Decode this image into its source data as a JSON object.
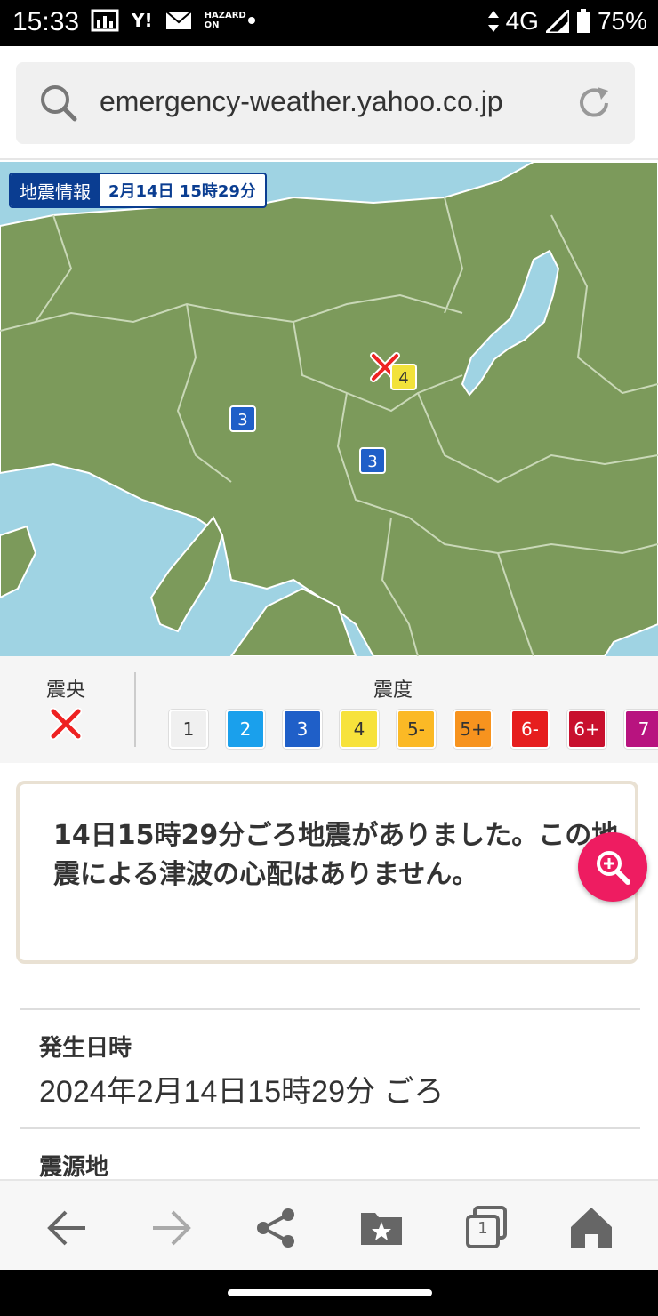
{
  "status": {
    "time": "15:33",
    "network": "4G",
    "battery": "75%",
    "icons": [
      "gallery-icon",
      "yahoo-icon",
      "mail-icon",
      "hazard-on-icon"
    ],
    "yahoo_text": "Y!",
    "hazard_text": "HAZARD ON"
  },
  "browser": {
    "url": "emergency-weather.yahoo.co.jp"
  },
  "map": {
    "badge_title": "地震情報",
    "badge_date": "2月14日 15時29分",
    "markers": [
      {
        "label": "4",
        "color": "#f2e23b"
      },
      {
        "label": "3",
        "color": "#1f5fc8"
      },
      {
        "label": "3",
        "color": "#1f5fc8"
      }
    ],
    "colors": {
      "land": "#7c9a5b",
      "sea": "#9fd3e3",
      "border": "#ffffff"
    }
  },
  "legend": {
    "epicenter_label": "震央",
    "intensity_label": "震度",
    "intensities": [
      {
        "label": "1",
        "color": "#f0f0f0",
        "text": "#333333"
      },
      {
        "label": "2",
        "color": "#1aa0ec",
        "text": "#ffffff"
      },
      {
        "label": "3",
        "color": "#1f5fc8",
        "text": "#ffffff"
      },
      {
        "label": "4",
        "color": "#f7e23b",
        "text": "#333333"
      },
      {
        "label": "5-",
        "color": "#fbb925",
        "text": "#333333"
      },
      {
        "label": "5+",
        "color": "#f7931e",
        "text": "#333333"
      },
      {
        "label": "6-",
        "color": "#e61e1e",
        "text": "#ffffff"
      },
      {
        "label": "6+",
        "color": "#c8102e",
        "text": "#ffffff"
      },
      {
        "label": "7",
        "color": "#b8137f",
        "text": "#ffffff"
      }
    ]
  },
  "info": {
    "message": "14日15時29分ごろ地震がありました。この地震による津波の心配はありません。"
  },
  "fields": [
    {
      "label": "発生日時",
      "value": "2024年2月14日15時29分 ごろ"
    },
    {
      "label": "震源地",
      "value": ""
    }
  ],
  "toolbar": {
    "buttons": [
      "back-icon",
      "forward-icon",
      "share-icon",
      "bookmark-icon",
      "tabs-icon",
      "home-icon"
    ],
    "tab_count": "1"
  }
}
